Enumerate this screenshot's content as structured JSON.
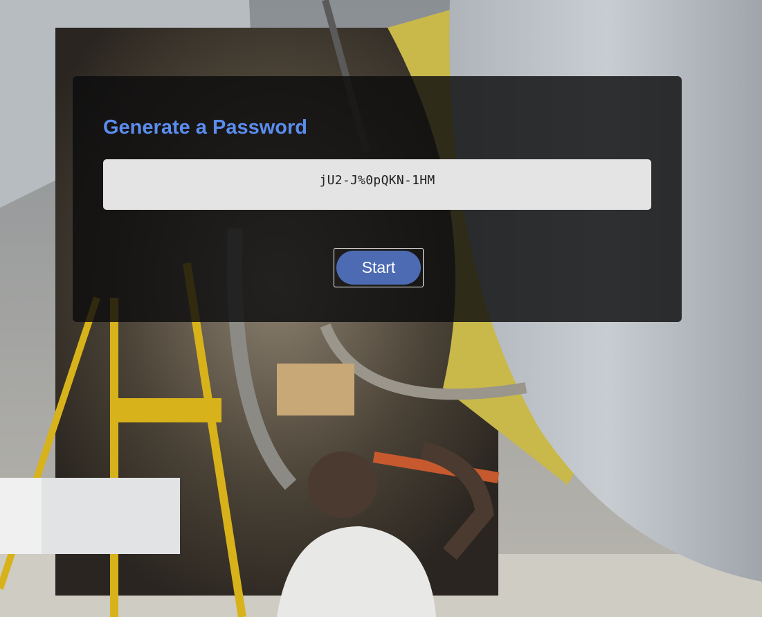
{
  "card": {
    "title": "Generate a Password",
    "password": "jU2-J%0pQKN-1HM",
    "start_label": "Start"
  },
  "colors": {
    "title": "#5b8def",
    "button": "#4d6bb3",
    "password_box": "#e4e4e4",
    "card_overlay": "#0c0c0e"
  }
}
